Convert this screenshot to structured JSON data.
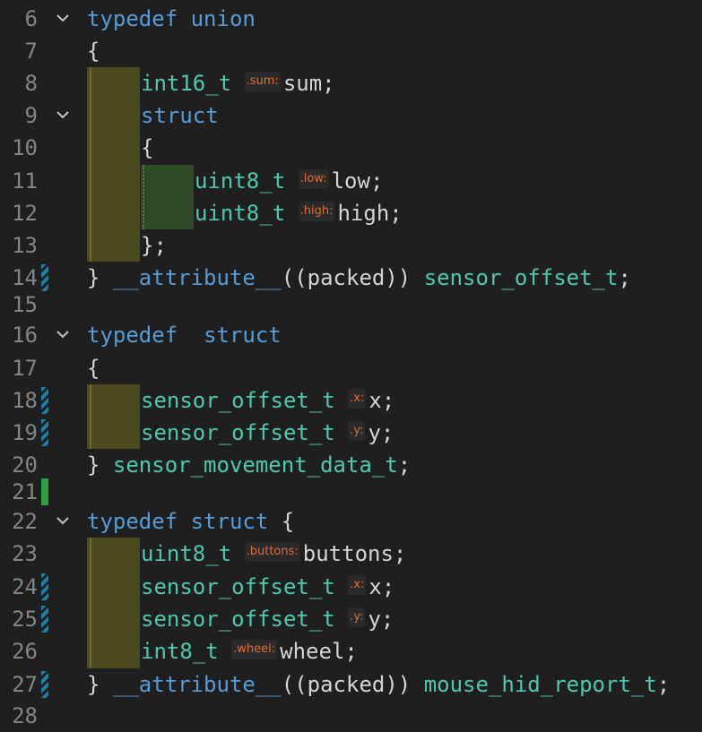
{
  "lines": [
    {
      "n": "6",
      "mark": "",
      "fold": true,
      "segs": [
        {
          "c": "kw",
          "t": "typedef"
        },
        {
          "c": "pl",
          "t": " "
        },
        {
          "c": "kw",
          "t": "union"
        }
      ]
    },
    {
      "n": "7",
      "mark": "",
      "fold": false,
      "segs": [
        {
          "c": "pl",
          "t": "{"
        }
      ]
    },
    {
      "n": "8",
      "mark": "",
      "fold": false,
      "indent": 1,
      "segs": [
        {
          "c": "ty",
          "t": "int16_t"
        },
        {
          "c": "pl",
          "t": " "
        },
        {
          "c": "hint",
          "t": ".sum:"
        },
        {
          "c": "pl",
          "t": "sum;"
        }
      ]
    },
    {
      "n": "9",
      "mark": "",
      "fold": true,
      "indent": 1,
      "segs": [
        {
          "c": "kw",
          "t": "struct"
        }
      ]
    },
    {
      "n": "10",
      "mark": "",
      "fold": false,
      "indent": 1,
      "segs": [
        {
          "c": "pl",
          "t": "{"
        }
      ]
    },
    {
      "n": "11",
      "mark": "",
      "fold": false,
      "indent": 2,
      "segs": [
        {
          "c": "ty",
          "t": "uint8_t"
        },
        {
          "c": "pl",
          "t": " "
        },
        {
          "c": "hint",
          "t": ".low:"
        },
        {
          "c": "pl",
          "t": "low;"
        }
      ]
    },
    {
      "n": "12",
      "mark": "",
      "fold": false,
      "indent": 2,
      "segs": [
        {
          "c": "ty",
          "t": "uint8_t"
        },
        {
          "c": "pl",
          "t": " "
        },
        {
          "c": "hint",
          "t": ".high:"
        },
        {
          "c": "pl",
          "t": "high;"
        }
      ]
    },
    {
      "n": "13",
      "mark": "",
      "fold": false,
      "indent": 1,
      "segs": [
        {
          "c": "pl",
          "t": "};"
        }
      ]
    },
    {
      "n": "14",
      "mark": "mod",
      "fold": false,
      "segs": [
        {
          "c": "pl",
          "t": "} "
        },
        {
          "c": "kw",
          "t": "__attribute__"
        },
        {
          "c": "pl",
          "t": "((packed)) "
        },
        {
          "c": "ty",
          "t": "sensor_offset_t"
        },
        {
          "c": "pl",
          "t": ";"
        }
      ]
    },
    {
      "n": "15",
      "mark": "",
      "fold": false,
      "segs": []
    },
    {
      "n": "16",
      "mark": "",
      "fold": true,
      "segs": [
        {
          "c": "kw",
          "t": "typedef"
        },
        {
          "c": "pl",
          "t": "  "
        },
        {
          "c": "kw",
          "t": "struct"
        }
      ]
    },
    {
      "n": "17",
      "mark": "",
      "fold": false,
      "segs": [
        {
          "c": "pl",
          "t": "{"
        }
      ]
    },
    {
      "n": "18",
      "mark": "mod",
      "fold": false,
      "indent": 1,
      "segs": [
        {
          "c": "ty",
          "t": "sensor_offset_t"
        },
        {
          "c": "pl",
          "t": " "
        },
        {
          "c": "hint",
          "t": ".x:"
        },
        {
          "c": "pl",
          "t": "x;"
        }
      ]
    },
    {
      "n": "19",
      "mark": "mod",
      "fold": false,
      "indent": 1,
      "segs": [
        {
          "c": "ty",
          "t": "sensor_offset_t"
        },
        {
          "c": "pl",
          "t": " "
        },
        {
          "c": "hint",
          "t": ".y:"
        },
        {
          "c": "pl",
          "t": "y;"
        }
      ]
    },
    {
      "n": "20",
      "mark": "",
      "fold": false,
      "segs": [
        {
          "c": "pl",
          "t": "} "
        },
        {
          "c": "ty",
          "t": "sensor_movement_data_t"
        },
        {
          "c": "pl",
          "t": ";"
        }
      ]
    },
    {
      "n": "21",
      "mark": "add",
      "fold": false,
      "segs": []
    },
    {
      "n": "22",
      "mark": "",
      "fold": true,
      "segs": [
        {
          "c": "kw",
          "t": "typedef"
        },
        {
          "c": "pl",
          "t": " "
        },
        {
          "c": "kw",
          "t": "struct"
        },
        {
          "c": "pl",
          "t": " {"
        }
      ]
    },
    {
      "n": "23",
      "mark": "",
      "fold": false,
      "indent": 1,
      "segs": [
        {
          "c": "ty",
          "t": "uint8_t"
        },
        {
          "c": "pl",
          "t": " "
        },
        {
          "c": "hint",
          "t": ".buttons:"
        },
        {
          "c": "pl",
          "t": "buttons;"
        }
      ]
    },
    {
      "n": "24",
      "mark": "mod",
      "fold": false,
      "indent": 1,
      "segs": [
        {
          "c": "ty",
          "t": "sensor_offset_t"
        },
        {
          "c": "pl",
          "t": " "
        },
        {
          "c": "hint",
          "t": ".x:"
        },
        {
          "c": "pl",
          "t": "x;"
        }
      ]
    },
    {
      "n": "25",
      "mark": "mod",
      "fold": false,
      "indent": 1,
      "segs": [
        {
          "c": "ty",
          "t": "sensor_offset_t"
        },
        {
          "c": "pl",
          "t": " "
        },
        {
          "c": "hint",
          "t": ".y:"
        },
        {
          "c": "pl",
          "t": "y;"
        }
      ]
    },
    {
      "n": "26",
      "mark": "",
      "fold": false,
      "indent": 1,
      "segs": [
        {
          "c": "ty",
          "t": "int8_t"
        },
        {
          "c": "pl",
          "t": " "
        },
        {
          "c": "hint",
          "t": ".wheel:"
        },
        {
          "c": "pl",
          "t": "wheel;"
        }
      ]
    },
    {
      "n": "27",
      "mark": "mod",
      "fold": false,
      "segs": [
        {
          "c": "pl",
          "t": "} "
        },
        {
          "c": "kw",
          "t": "__attribute__"
        },
        {
          "c": "pl",
          "t": "((packed)) "
        },
        {
          "c": "ty",
          "t": "mouse_hid_report_t"
        },
        {
          "c": "pl",
          "t": ";"
        }
      ]
    },
    {
      "n": "28",
      "mark": "",
      "fold": false,
      "segs": []
    }
  ],
  "colors": {
    "background": "#1f1f1f",
    "keyword": "#569cd6",
    "type": "#4ec9b0",
    "text": "#d4d4d4",
    "line_number": "#858585",
    "inlay_hint": "#e06c3a",
    "modified_marker": "#1b81a8",
    "added_marker": "#2ea043"
  },
  "icons": {
    "fold": "chevron-down-icon"
  }
}
